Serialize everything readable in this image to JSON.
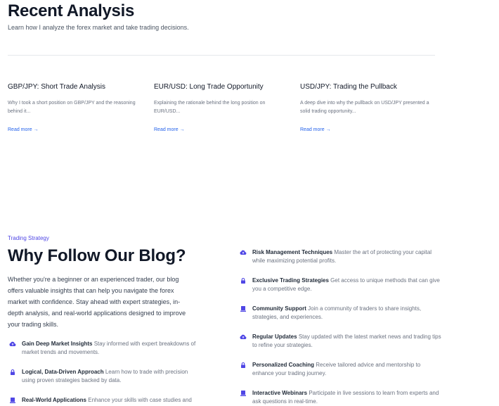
{
  "recent": {
    "title": "Recent Analysis",
    "subtitle": "Learn how I analyze the forex market and take trading decisions.",
    "cards": [
      {
        "title": "GBP/JPY: Short Trade Analysis",
        "excerpt": "Why I took a short position on GBP/JPY and the reasoning behind it...",
        "link": "Read more →"
      },
      {
        "title": "EUR/USD: Long Trade Opportunity",
        "excerpt": "Explaining the rationale behind the long position on EUR/USD...",
        "link": "Read more →"
      },
      {
        "title": "USD/JPY: Trading the Pullback",
        "excerpt": "A deep dive into why the pullback on USD/JPY presented a solid trading opportunity...",
        "link": "Read more →"
      }
    ]
  },
  "why": {
    "eyebrow": "Trading Strategy",
    "title": "Why Follow Our Blog?",
    "intro": "Whether you're a beginner or an experienced trader, our blog offers valuable insights that can help you navigate the forex market with confidence. Stay ahead with expert strategies, in-depth analysis, and real-world applications designed to improve your trading skills.",
    "accent": "#4f46e5",
    "left_features": [
      {
        "icon": "cloud-upload-icon",
        "title": "Gain Deep Market Insights",
        "desc": "Stay informed with expert breakdowns of market trends and movements."
      },
      {
        "icon": "lock-icon",
        "title": "Logical, Data-Driven Approach",
        "desc": "Learn how to trade with precision using proven strategies backed by data."
      },
      {
        "icon": "server-icon",
        "title": "Real-World Applications",
        "desc": "Enhance your skills with case studies and"
      }
    ],
    "right_features": [
      {
        "icon": "cloud-upload-icon",
        "title": "Risk Management Techniques",
        "desc": "Master the art of protecting your capital while maximizing potential profits."
      },
      {
        "icon": "lock-icon",
        "title": "Exclusive Trading Strategies",
        "desc": "Get access to unique methods that can give you a competitive edge."
      },
      {
        "icon": "server-icon",
        "title": "Community Support",
        "desc": "Join a community of traders to share insights, strategies, and experiences."
      },
      {
        "icon": "cloud-upload-icon",
        "title": "Regular Updates",
        "desc": "Stay updated with the latest market news and trading tips to refine your strategies."
      },
      {
        "icon": "lock-icon",
        "title": "Personalized Coaching",
        "desc": "Receive tailored advice and mentorship to enhance your trading journey."
      },
      {
        "icon": "server-icon",
        "title": "Interactive Webinars",
        "desc": "Participate in live sessions to learn from experts and ask questions in real-time."
      }
    ]
  }
}
